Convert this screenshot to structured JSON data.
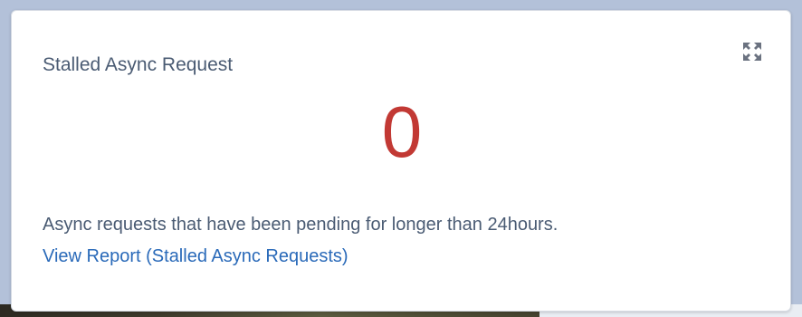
{
  "card": {
    "title": "Stalled Async Request",
    "value": "0",
    "description": "Async requests that have been pending for longer than 24hours.",
    "link_label": "View Report (Stalled Async Requests)",
    "expand_icon": "expand-arrows-icon"
  },
  "colors": {
    "value_color": "#c23934",
    "link_color": "#2a6ab9",
    "text_color": "#4a5b73",
    "page_background": "#b3c1d9"
  }
}
